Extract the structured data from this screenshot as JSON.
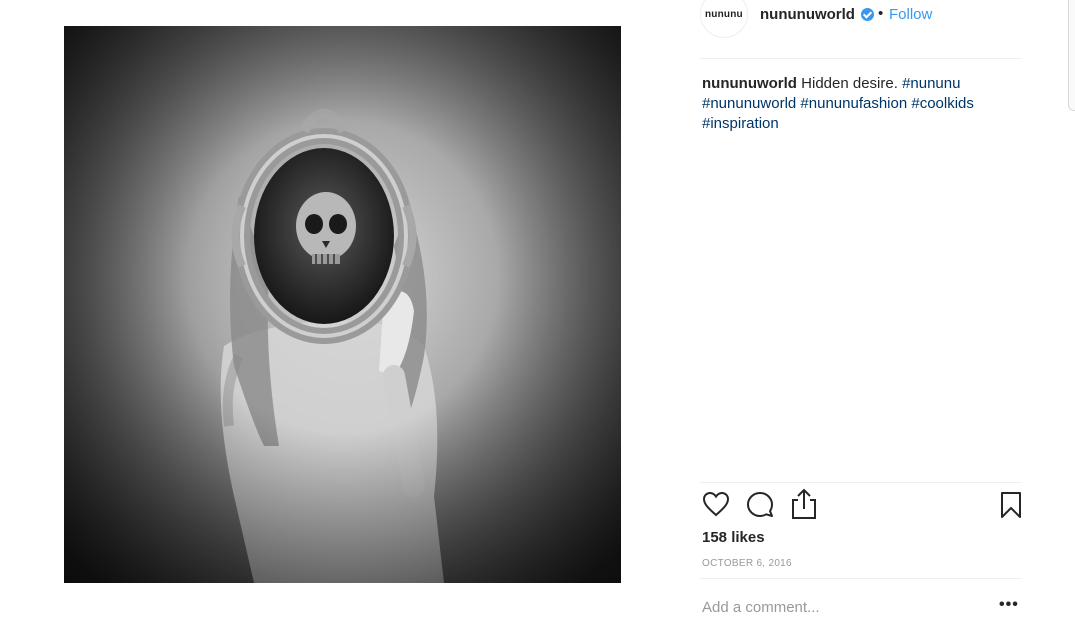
{
  "post": {
    "image_description": "black-and-white photo of a girl holding an ornate oval mirror reflecting a skull",
    "account": {
      "avatar_text": "nununu",
      "username": "nununuworld",
      "verified": true,
      "separator": "•",
      "follow_label": "Follow"
    },
    "caption": {
      "username": "nununuworld",
      "text": "Hidden desire.",
      "hashtags": [
        "#nununu",
        "#nununuworld",
        "#nununufashion",
        "#coolkids",
        "#inspiration"
      ]
    },
    "actions": {
      "like_icon": "heart-icon",
      "comment_icon": "comment-icon",
      "share_icon": "share-icon",
      "save_icon": "bookmark-icon"
    },
    "likes": "158 likes",
    "date": "OCTOBER 6, 2016",
    "comment_placeholder": "Add a comment...",
    "more_label": "•••"
  },
  "colors": {
    "link_blue": "#3897f0",
    "hashtag": "#003569",
    "muted": "#999999",
    "text": "#262626"
  }
}
